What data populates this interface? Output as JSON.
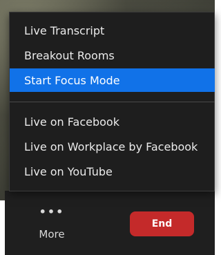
{
  "menu": {
    "items_top": [
      {
        "label": "Live Transcript"
      },
      {
        "label": "Breakout Rooms"
      },
      {
        "label": "Start Focus Mode",
        "highlighted": true
      }
    ],
    "items_bottom": [
      {
        "label": "Live on Facebook"
      },
      {
        "label": "Live on Workplace by Facebook"
      },
      {
        "label": "Live on YouTube"
      }
    ]
  },
  "toolbar": {
    "more_icon": "ellipsis-icon",
    "more_dots": "•••",
    "more_label": "More",
    "end_label": "End"
  },
  "colors": {
    "menu_background": "#1e1e1e",
    "highlight": "#1172e8",
    "end_button": "#c42a2a",
    "toolbar": "#1f1f1f"
  }
}
